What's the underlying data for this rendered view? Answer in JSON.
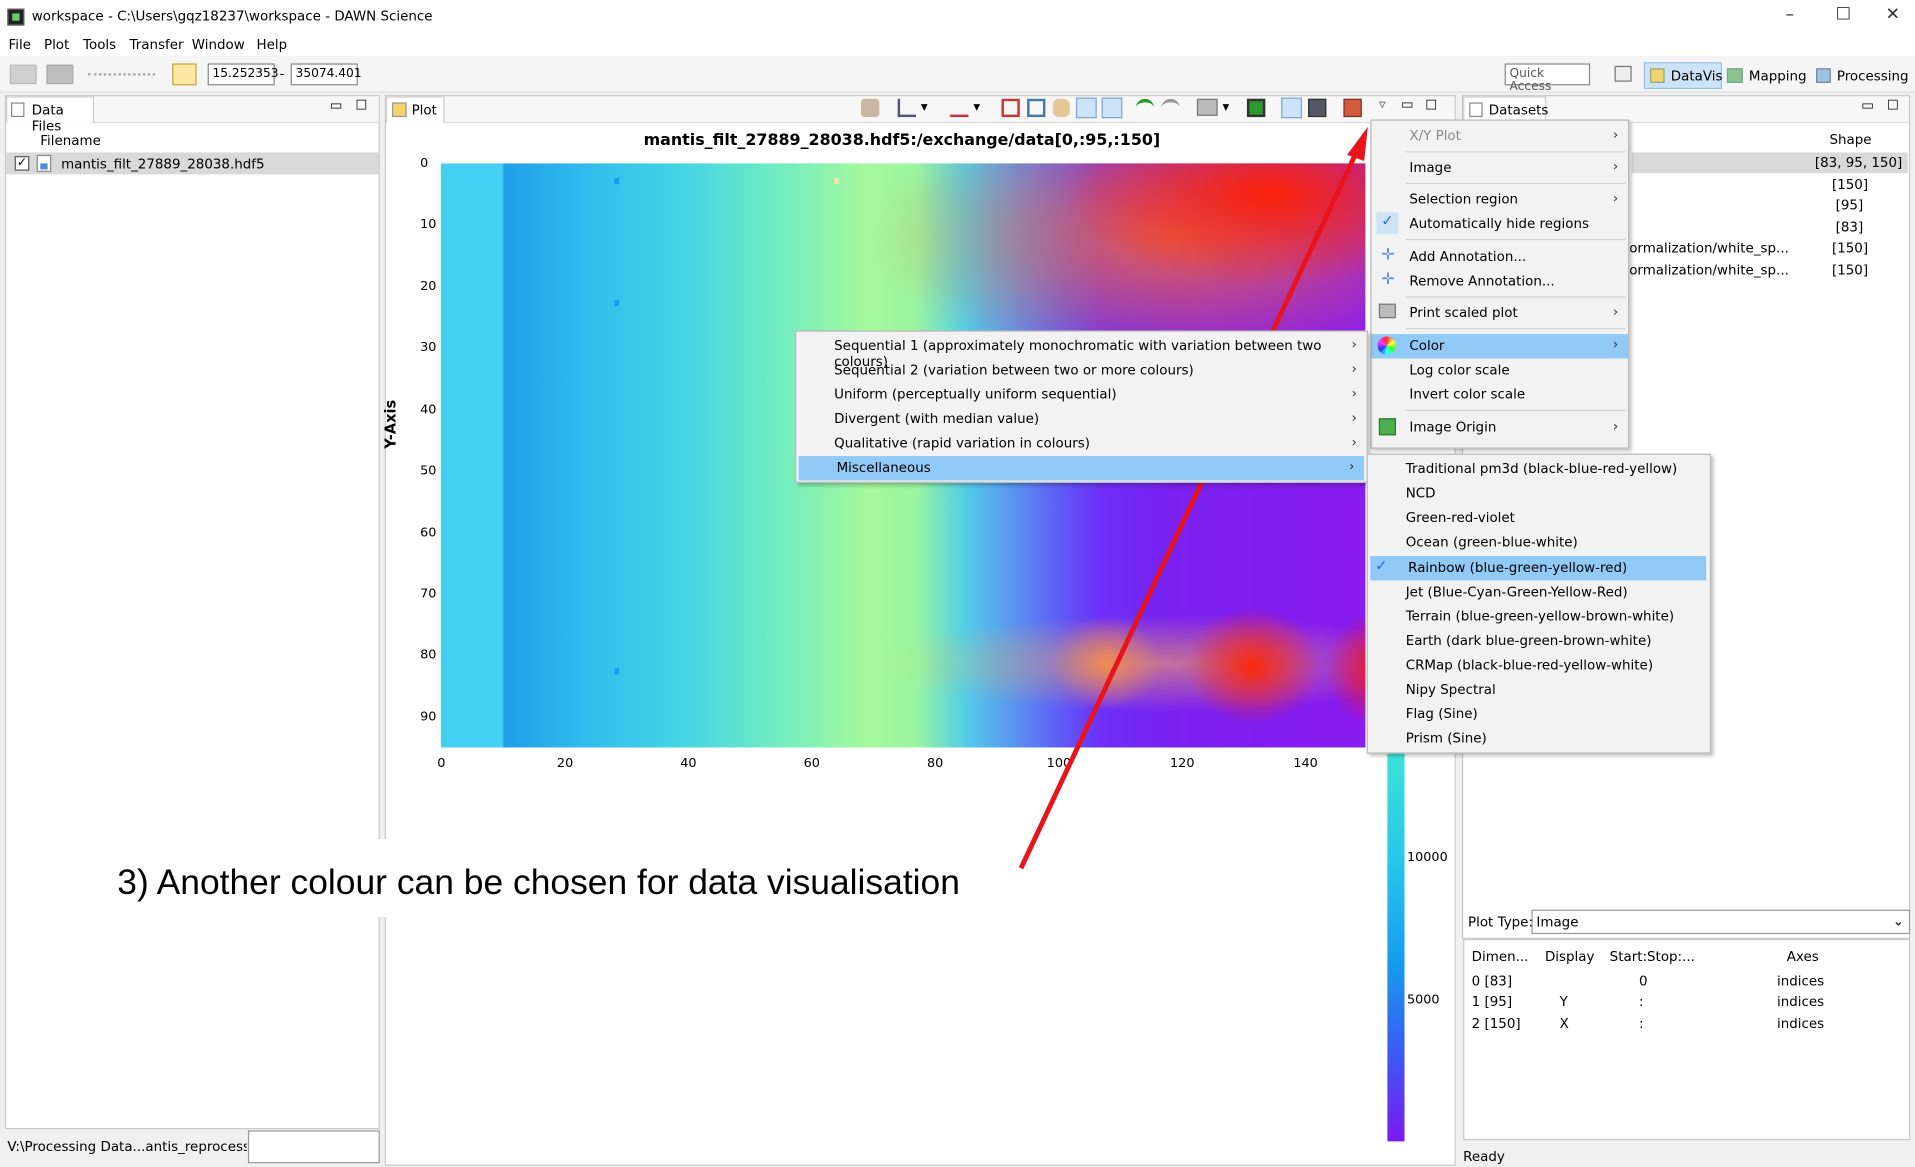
{
  "window": {
    "title": "workspace - C:\\Users\\gqz18237\\workspace - DAWN Science",
    "controls": [
      "–",
      "☐",
      "✕"
    ]
  },
  "menubar": [
    "File",
    "Plot",
    "Tools",
    "Transfer",
    "Window",
    "Help"
  ],
  "toolbar": {
    "range_min": "15.252353",
    "range_sep": "-",
    "range_max": "35074.401",
    "quick_access": "Quick Access",
    "perspectives": [
      "DataVis",
      "Mapping",
      "Processing"
    ]
  },
  "data_files": {
    "tab": "Data Files",
    "col_header": "Filename",
    "files": [
      "mantis_filt_27889_28038.hdf5"
    ],
    "status_path": "V:\\Processing Data...antis_reprocessing"
  },
  "plot": {
    "tab": "Plot",
    "title": "mantis_filt_27889_28038.hdf5:/exchange/data[0,:95,:150]",
    "y_axis_label": "Y-Axis",
    "y_ticks": [
      "0",
      "10",
      "20",
      "30",
      "40",
      "50",
      "60",
      "70",
      "80",
      "90"
    ],
    "x_ticks": [
      "0",
      "20",
      "40",
      "60",
      "80",
      "100",
      "120",
      "140"
    ],
    "colorbar_ticks": [
      "10000",
      "5000"
    ]
  },
  "datasets": {
    "tab": "Datasets",
    "col_shape": "Shape",
    "rows": [
      {
        "name": "",
        "shape": "[83, 95, 150]"
      },
      {
        "name": "",
        "shape": "[150]"
      },
      {
        "name": "",
        "shape": "[95]"
      },
      {
        "name": "",
        "shape": "[83]"
      },
      {
        "name": "ormalization/white_sp...",
        "shape": "[150]"
      },
      {
        "name": "ormalization/white_sp...",
        "shape": "[150]"
      }
    ],
    "plot_type_label": "Plot Type:",
    "plot_type_value": "Image",
    "dims_headers": [
      "Dimen...",
      "Display",
      "Start:Stop:...",
      "Axes"
    ],
    "dims": [
      {
        "dim": "0 [83]",
        "display": "",
        "range": "0",
        "axes": "indices"
      },
      {
        "dim": "1 [95]",
        "display": "Y",
        "range": ":",
        "axes": "indices"
      },
      {
        "dim": "2 [150]",
        "display": "X",
        "range": ":",
        "axes": "indices"
      }
    ],
    "status": "Ready"
  },
  "plot_menu": [
    {
      "label": "X/Y Plot",
      "arrow": "›",
      "disabled": true
    },
    {
      "label": "Image",
      "arrow": "›"
    },
    {
      "label": "Selection region",
      "arrow": "›"
    },
    {
      "label": "Automatically hide regions",
      "checked": true
    },
    {
      "label": "Add Annotation..."
    },
    {
      "label": "Remove Annotation..."
    },
    {
      "label": "Print scaled plot",
      "arrow": "›"
    },
    {
      "label": "Color",
      "arrow": "›",
      "selected": true
    },
    {
      "label": "Log color scale"
    },
    {
      "label": "Invert color scale"
    },
    {
      "label": "Image Origin",
      "arrow": "›"
    }
  ],
  "color_menu": [
    {
      "label": "Sequential 1 (approximately monochromatic with variation between two colours)",
      "arrow": "›"
    },
    {
      "label": "Sequential 2 (variation between two or more colours)",
      "arrow": "›"
    },
    {
      "label": "Uniform (perceptually uniform sequential)",
      "arrow": "›"
    },
    {
      "label": "Divergent (with median value)",
      "arrow": "›"
    },
    {
      "label": "Qualitative (rapid variation in colours)",
      "arrow": "›"
    },
    {
      "label": "Miscellaneous",
      "arrow": "›",
      "selected": true
    }
  ],
  "misc_menu": [
    {
      "label": "Traditional pm3d (black-blue-red-yellow)"
    },
    {
      "label": "NCD"
    },
    {
      "label": "Green-red-violet"
    },
    {
      "label": "Ocean (green-blue-white)"
    },
    {
      "label": "Rainbow (blue-green-yellow-red)",
      "checked": true
    },
    {
      "label": "Jet (Blue-Cyan-Green-Yellow-Red)"
    },
    {
      "label": "Terrain (blue-green-yellow-brown-white)"
    },
    {
      "label": "Earth (dark blue-green-brown-white)"
    },
    {
      "label": "CRMap (black-blue-red-yellow-white)"
    },
    {
      "label": "Nipy Spectral"
    },
    {
      "label": "Flag (Sine)"
    },
    {
      "label": "Prism (Sine)"
    }
  ],
  "annotation": {
    "text": "3) Another colour can be chosen for data visualisation",
    "arrow_color": "#e8141a"
  },
  "colors": {
    "menu_highlight": "#91c9f7",
    "check": "#1e6fd9"
  }
}
